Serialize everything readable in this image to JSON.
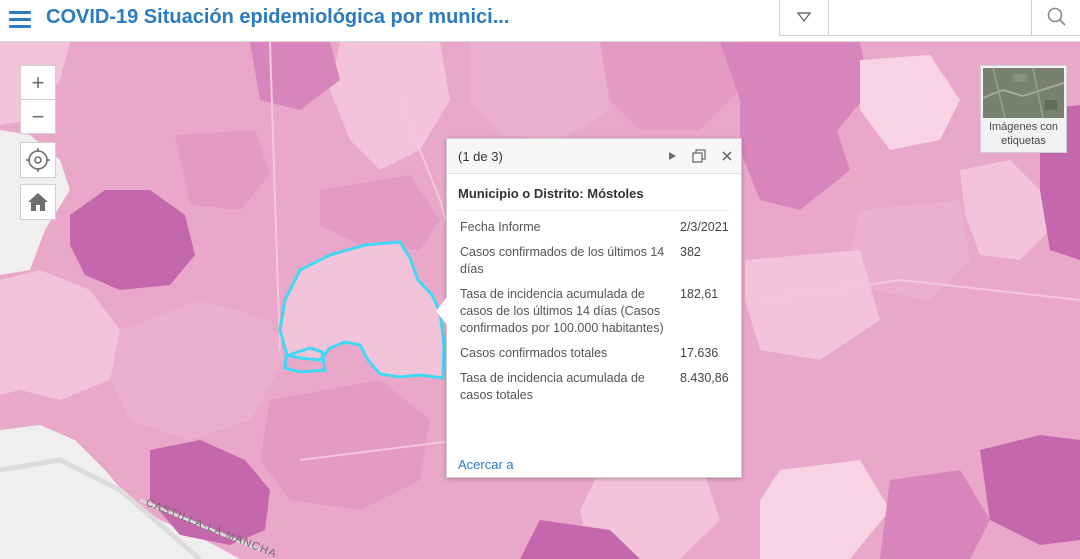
{
  "app": {
    "title": "COVID-19 Situación epidemiológica por munici..."
  },
  "search": {
    "placeholder": "",
    "value": ""
  },
  "map": {
    "road_label": "CASTILLA-LA MANCHA",
    "colors": {
      "light_pink": "#f2c3d9",
      "mid_pink": "#e9a7c9",
      "dark_pink": "#d985bd",
      "darkest_pink": "#c567ad",
      "highlight": "#42d7f4",
      "outside": "#efefef"
    }
  },
  "controls": {
    "zoom_in": "+",
    "zoom_out": "−"
  },
  "basemap": {
    "label": "Imágenes con etiquetas"
  },
  "popup": {
    "count": "(1 de 3)",
    "title": "Municipio o Distrito: Móstoles",
    "fields": [
      {
        "label": "Fecha Informe",
        "value": "2/3/2021"
      },
      {
        "label": "Casos confirmados de los últimos 14 días",
        "value": "382"
      },
      {
        "label": "Tasa de incidencia acumulada de casos de los últimos 14 días (Casos confirmados por 100.000 habitantes)",
        "value": "182,61"
      },
      {
        "label": "Casos confirmados totales",
        "value": "17.636"
      },
      {
        "label": "Tasa de incidencia acumulada de casos totales",
        "value": "8.430,86"
      }
    ],
    "zoom_link": "Acercar a"
  }
}
